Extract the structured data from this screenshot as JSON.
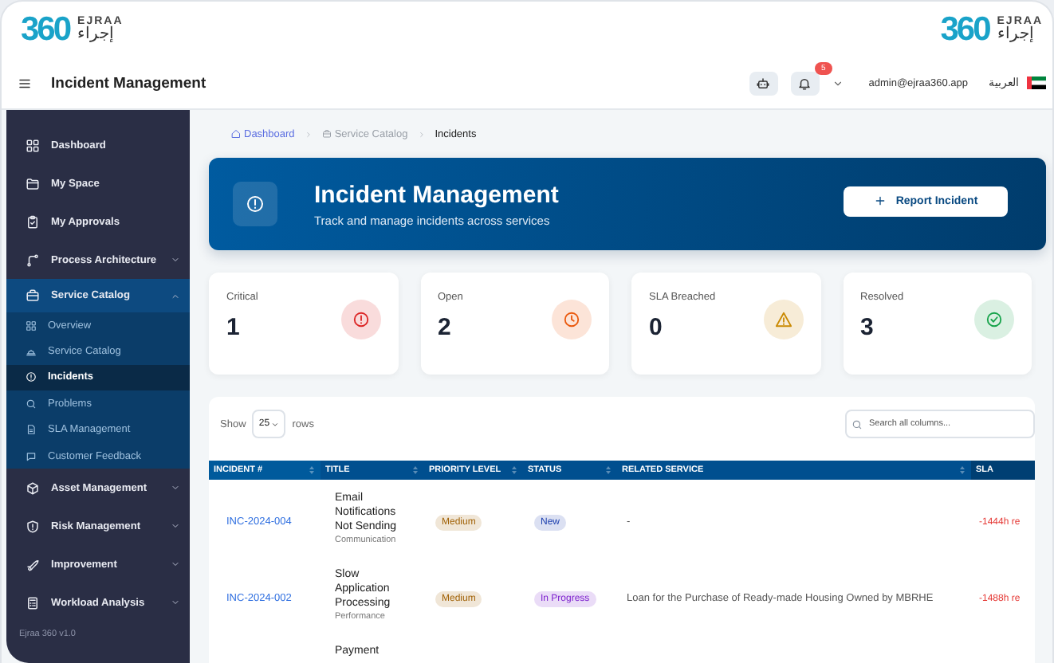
{
  "header": {
    "logo_left": {
      "mark": "360",
      "name": "EJRAA",
      "name_ar": "إجراء"
    },
    "logo_right": {
      "mark": "360",
      "name": "EJRAA",
      "name_ar": "إجراء"
    },
    "page_title": "Incident Management",
    "notifications": "5",
    "user": "admin@ejraa360.app",
    "language": "العربية"
  },
  "sidebar": {
    "items": [
      {
        "label": "Dashboard",
        "kind": "link"
      },
      {
        "label": "My Space",
        "kind": "link"
      },
      {
        "label": "My Approvals",
        "kind": "link"
      },
      {
        "label": "Process Architecture",
        "kind": "group",
        "expanded": false
      },
      {
        "label": "Service Catalog",
        "kind": "group",
        "expanded": true,
        "children": [
          {
            "label": "Overview",
            "selected": false
          },
          {
            "label": "Service Catalog",
            "selected": false
          },
          {
            "label": "Incidents",
            "selected": true
          },
          {
            "label": "Problems",
            "selected": false
          },
          {
            "label": "SLA Management",
            "selected": false
          },
          {
            "label": "Customer Feedback",
            "selected": false
          }
        ]
      },
      {
        "label": "Asset Management",
        "kind": "group",
        "expanded": false
      },
      {
        "label": "Risk Management",
        "kind": "group",
        "expanded": false
      },
      {
        "label": "Improvement",
        "kind": "group",
        "expanded": false
      },
      {
        "label": "Workload Analysis",
        "kind": "group",
        "expanded": false
      }
    ],
    "version": "Ejraa 360 v1.0"
  },
  "breadcrumb": [
    {
      "label": "Dashboard",
      "kind": "link"
    },
    {
      "label": "Service Catalog",
      "kind": "link"
    },
    {
      "label": "Incidents",
      "kind": "current"
    }
  ],
  "banner": {
    "title": "Incident Management",
    "subtitle": "Track and manage incidents across services",
    "button": "Report Incident"
  },
  "stats": [
    {
      "label": "Critical",
      "value": "1",
      "color": "#dc2626"
    },
    {
      "label": "Open",
      "value": "2",
      "color": "#ea580c"
    },
    {
      "label": "SLA Breached",
      "value": "0",
      "color": "#ca8a04"
    },
    {
      "label": "Resolved",
      "value": "3",
      "color": "#16a34a"
    }
  ],
  "table": {
    "show_label": "Show",
    "page_size": "25",
    "rows_label": "rows",
    "search": {
      "placeholder": "Search all columns..."
    },
    "columns": [
      {
        "label": "INCIDENT #",
        "sortable": true
      },
      {
        "label": "TITLE",
        "sortable": true
      },
      {
        "label": "PRIORITY LEVEL",
        "sortable": true
      },
      {
        "label": "STATUS",
        "sortable": true
      },
      {
        "label": "RELATED SERVICE",
        "sortable": true
      },
      {
        "label": "SLA",
        "sortable": false
      }
    ],
    "rows": [
      {
        "incident": "INC-2024-004",
        "title": "Email Notifications Not Sending",
        "category": "Communication",
        "priority": {
          "label": "Medium",
          "color": "#a16207"
        },
        "status": {
          "label": "New",
          "color": "#1e40af"
        },
        "service": "-",
        "sla": "-1444h re"
      },
      {
        "incident": "INC-2024-002",
        "title": "Slow Application Processing",
        "category": "Performance",
        "priority": {
          "label": "Medium",
          "color": "#a16207"
        },
        "status": {
          "label": "In Progress",
          "color": "#7e22ce"
        },
        "service": "Loan for the Purchase of Ready-made Housing Owned by MBRHE",
        "sla": "-1488h re"
      },
      {
        "title": "Payment"
      }
    ]
  }
}
